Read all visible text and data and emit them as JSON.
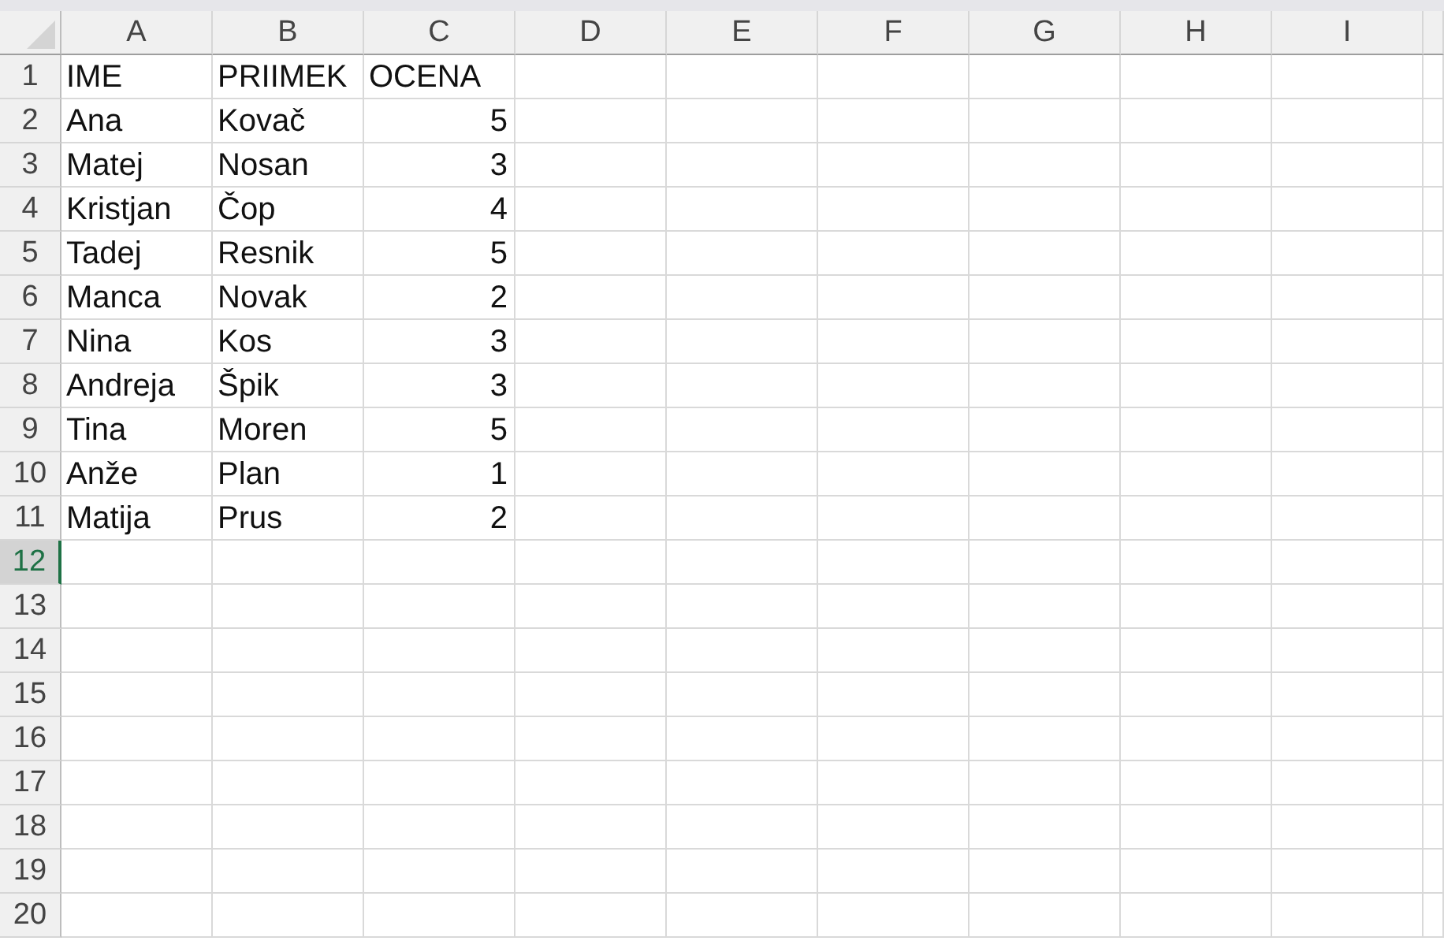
{
  "sheet": {
    "columns": [
      "A",
      "B",
      "C",
      "D",
      "E",
      "F",
      "G",
      "H",
      "I"
    ],
    "rows": [
      {
        "number": "1",
        "selected": false,
        "cells": [
          {
            "value": "IME",
            "kind": "text"
          },
          {
            "value": "PRIIMEK",
            "kind": "text"
          },
          {
            "value": "OCENA",
            "kind": "text"
          }
        ]
      },
      {
        "number": "2",
        "selected": false,
        "cells": [
          {
            "value": "Ana",
            "kind": "text"
          },
          {
            "value": "Kovač",
            "kind": "text"
          },
          {
            "value": "5",
            "kind": "number"
          }
        ]
      },
      {
        "number": "3",
        "selected": false,
        "cells": [
          {
            "value": "Matej",
            "kind": "text"
          },
          {
            "value": "Nosan",
            "kind": "text"
          },
          {
            "value": "3",
            "kind": "number"
          }
        ]
      },
      {
        "number": "4",
        "selected": false,
        "cells": [
          {
            "value": "Kristjan",
            "kind": "text"
          },
          {
            "value": "Čop",
            "kind": "text"
          },
          {
            "value": "4",
            "kind": "number"
          }
        ]
      },
      {
        "number": "5",
        "selected": false,
        "cells": [
          {
            "value": "Tadej",
            "kind": "text"
          },
          {
            "value": "Resnik",
            "kind": "text"
          },
          {
            "value": "5",
            "kind": "number"
          }
        ]
      },
      {
        "number": "6",
        "selected": false,
        "cells": [
          {
            "value": "Manca",
            "kind": "text"
          },
          {
            "value": "Novak",
            "kind": "text"
          },
          {
            "value": "2",
            "kind": "number"
          }
        ]
      },
      {
        "number": "7",
        "selected": false,
        "cells": [
          {
            "value": "Nina",
            "kind": "text"
          },
          {
            "value": "Kos",
            "kind": "text"
          },
          {
            "value": "3",
            "kind": "number"
          }
        ]
      },
      {
        "number": "8",
        "selected": false,
        "cells": [
          {
            "value": "Andreja",
            "kind": "text"
          },
          {
            "value": "Špik",
            "kind": "text"
          },
          {
            "value": "3",
            "kind": "number"
          }
        ]
      },
      {
        "number": "9",
        "selected": false,
        "cells": [
          {
            "value": "Tina",
            "kind": "text"
          },
          {
            "value": "Moren",
            "kind": "text"
          },
          {
            "value": "5",
            "kind": "number"
          }
        ]
      },
      {
        "number": "10",
        "selected": false,
        "cells": [
          {
            "value": "Anže",
            "kind": "text"
          },
          {
            "value": "Plan",
            "kind": "text"
          },
          {
            "value": "1",
            "kind": "number"
          }
        ]
      },
      {
        "number": "11",
        "selected": false,
        "cells": [
          {
            "value": "Matija",
            "kind": "text"
          },
          {
            "value": "Prus",
            "kind": "text"
          },
          {
            "value": "2",
            "kind": "number"
          }
        ]
      },
      {
        "number": "12",
        "selected": true
      },
      {
        "number": "13",
        "selected": false
      },
      {
        "number": "14",
        "selected": false
      },
      {
        "number": "15",
        "selected": false
      },
      {
        "number": "16",
        "selected": false
      },
      {
        "number": "17",
        "selected": false
      },
      {
        "number": "18",
        "selected": false
      },
      {
        "number": "19",
        "selected": false
      },
      {
        "number": "20",
        "selected": false
      }
    ]
  }
}
